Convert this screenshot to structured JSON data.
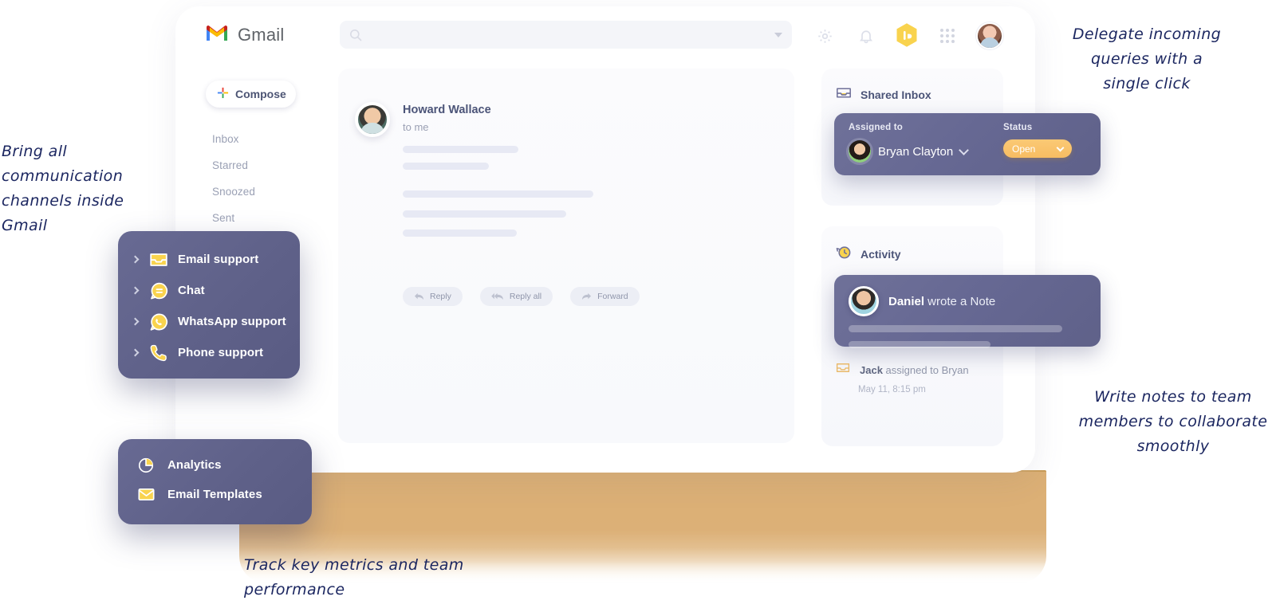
{
  "header": {
    "brand": "Gmail",
    "search_placeholder": "",
    "search_value": "",
    "icons": {
      "search": "search-icon",
      "filter": "filter-caret-icon",
      "settings": "gear-icon",
      "notifications": "bell-icon",
      "hiver": "hexagon-bar-chart-icon",
      "apps": "grid-apps-icon",
      "profile": "user-avatar"
    }
  },
  "sidebar": {
    "compose_label": "Compose",
    "items": [
      {
        "label": "Inbox"
      },
      {
        "label": "Starred"
      },
      {
        "label": "Snoozed"
      },
      {
        "label": "Sent"
      }
    ]
  },
  "mail": {
    "sender": "Howard Wallace",
    "recipient": "to me",
    "actions": [
      {
        "label": "Reply",
        "icon": "reply-arrow-icon"
      },
      {
        "label": "Reply all",
        "icon": "reply-all-arrow-icon"
      },
      {
        "label": "Forward",
        "icon": "forward-arrow-icon"
      }
    ]
  },
  "shared_inbox": {
    "title": "Shared Inbox",
    "icon": "inbox-tray-icon",
    "assigned_label": "Assigned to",
    "assignee": "Bryan Clayton",
    "status_label": "Status",
    "status_value": "Open"
  },
  "activity": {
    "title": "Activity",
    "icon": "history-clock-icon",
    "note": {
      "author": "Daniel",
      "text": " wrote a Note"
    },
    "entry": {
      "actor": "Jack",
      "text": " assigned to Bryan",
      "icon": "inbox-tray-icon"
    },
    "timestamp": "May 11, 8:15 pm"
  },
  "channels_menu": {
    "items": [
      {
        "label": "Email support",
        "icon": "inbox-tray-icon"
      },
      {
        "label": "Chat",
        "icon": "chat-bubble-icon"
      },
      {
        "label": "WhatsApp support",
        "icon": "whatsapp-icon"
      },
      {
        "label": "Phone support",
        "icon": "phone-icon"
      }
    ]
  },
  "tools_menu": {
    "items": [
      {
        "label": "Analytics",
        "icon": "pie-chart-icon"
      },
      {
        "label": "Email Templates",
        "icon": "envelope-icon"
      }
    ]
  },
  "annotations": {
    "left": "Bring all communication channels inside Gmail",
    "top_right": "Delegate incoming queries with a single click",
    "bottom_right": "Write notes to team members to collaborate smoothly",
    "bottom": "Track key metrics and team performance"
  },
  "colors": {
    "purple": "#5f6189",
    "yellow": "#f9d34e",
    "status_orange": "#f9c16a",
    "gold_band": "#dcb077",
    "annotation_ink": "#1b2660"
  }
}
